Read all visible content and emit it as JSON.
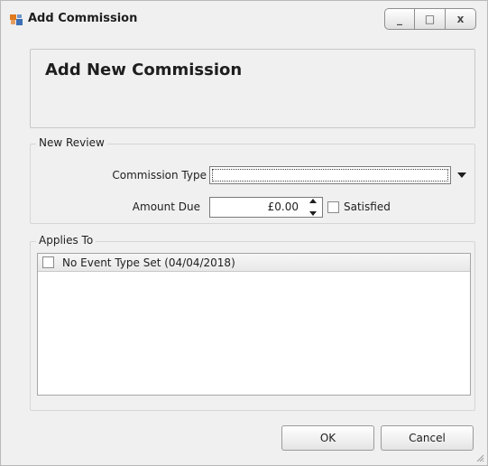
{
  "window": {
    "title": "Add Commission",
    "minimize_glyph": "_",
    "maximize_glyph": "□",
    "close_glyph": "x"
  },
  "header": {
    "title": "Add New Commission"
  },
  "new_review": {
    "group_label": "New Review",
    "commission_type_label": "Commission Type",
    "commission_type_value": "",
    "amount_due_label": "Amount Due",
    "amount_due_value": "£0.00",
    "satisfied_label": "Satisfied",
    "satisfied_checked": false
  },
  "applies_to": {
    "group_label": "Applies To",
    "items": [
      {
        "label": "No Event Type Set (04/04/2018)",
        "checked": false
      }
    ]
  },
  "buttons": {
    "ok_label": "OK",
    "cancel_label": "Cancel"
  },
  "icons": {
    "app": "window-app-icon",
    "dropdown": "chevron-down-icon",
    "spin_up": "spin-up-icon",
    "spin_down": "spin-down-icon",
    "resize": "resize-grip-icon"
  },
  "colors": {
    "window_bg": "#f0f0f0",
    "border": "#b9b9b9",
    "app_icon_orange": "#e07a1f",
    "app_icon_blue": "#3b6fb6"
  }
}
